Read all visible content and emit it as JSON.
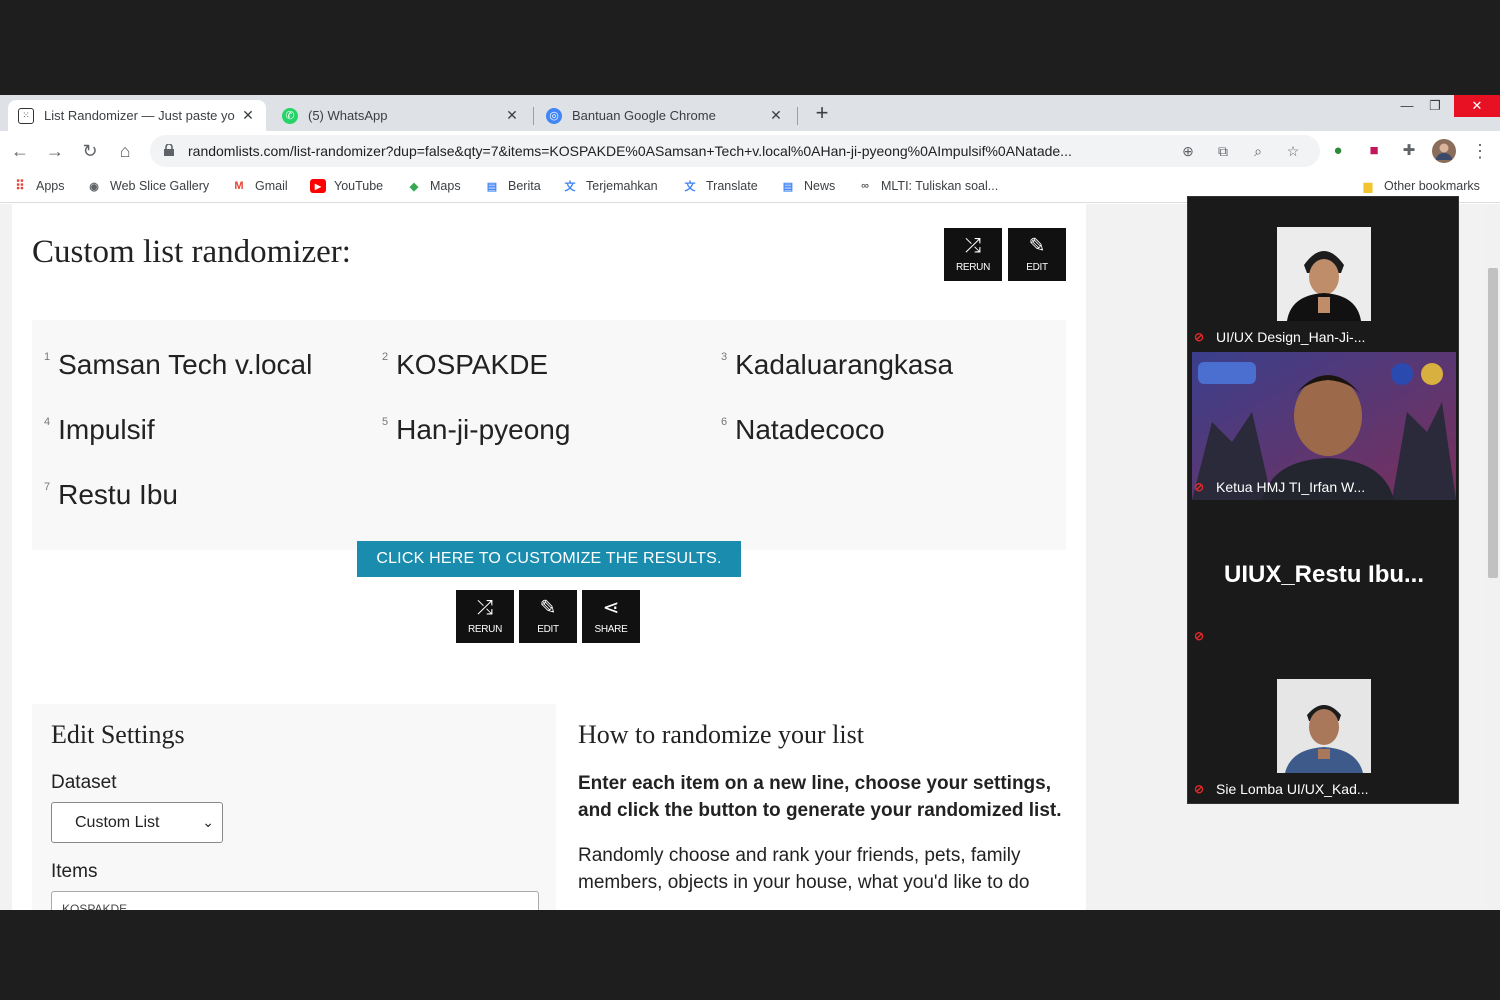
{
  "browser": {
    "tabs": [
      {
        "label": "List Randomizer — Just paste yo",
        "active": true
      },
      {
        "label": "(5) WhatsApp",
        "active": false
      },
      {
        "label": "Bantuan Google Chrome",
        "active": false
      }
    ],
    "url": "randomlists.com/list-randomizer?dup=false&qty=7&items=KOSPAKDE%0ASamsan+Tech+v.local%0AHan-ji-pyeong%0AImpulsif%0ANatade...",
    "bookmarks": [
      "Apps",
      "Web Slice Gallery",
      "Gmail",
      "YouTube",
      "Maps",
      "Berita",
      "Terjemahkan",
      "Translate",
      "News",
      "MLTI: Tuliskan soal..."
    ],
    "other_bookmarks": "Other bookmarks"
  },
  "page": {
    "title": "Custom list randomizer:",
    "top_buttons": {
      "rerun": "RERUN",
      "edit": "EDIT"
    },
    "results": [
      {
        "n": "1",
        "text": "Samsan Tech v.local"
      },
      {
        "n": "2",
        "text": "KOSPAKDE"
      },
      {
        "n": "3",
        "text": "Kadaluarangkasa"
      },
      {
        "n": "4",
        "text": "Impulsif"
      },
      {
        "n": "5",
        "text": "Han-ji-pyeong"
      },
      {
        "n": "6",
        "text": "Natadecoco"
      },
      {
        "n": "7",
        "text": "Restu Ibu"
      }
    ],
    "customize_button": "CLICK HERE TO CUSTOMIZE THE RESULTS.",
    "bottom_buttons": {
      "rerun": "RERUN",
      "edit": "EDIT",
      "share": "SHARE"
    },
    "settings": {
      "title": "Edit Settings",
      "dataset_label": "Dataset",
      "dataset_value": "Custom List",
      "items_label": "Items",
      "items_value": "KOSPAKDE"
    },
    "howto": {
      "title": "How to randomize your list",
      "bold_text": "Enter each item on a new line, choose your settings, and click the button to generate your randomized list.",
      "body_text": "Randomly choose and rank your friends, pets, family members, objects in your house, what you'd like to do"
    }
  },
  "meeting": {
    "participants": [
      {
        "name": "UI/UX Design_Han-Ji-..."
      },
      {
        "name": "Ketua HMJ TI_Irfan W..."
      },
      {
        "name": "UIUX_Restu  Ibu..."
      },
      {
        "name": "Sie Lomba UI/UX_Kad..."
      }
    ]
  },
  "colors": {
    "accent": "#1a8cae",
    "button_dark": "#111111",
    "mic_muted": "#e02828"
  }
}
